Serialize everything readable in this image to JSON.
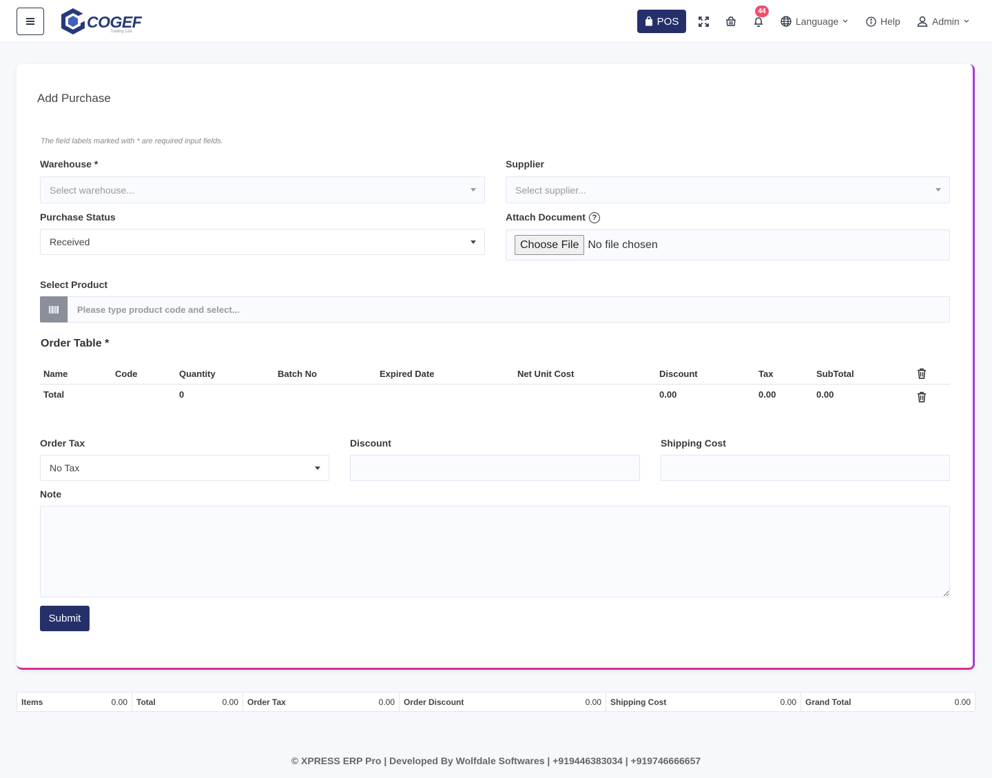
{
  "header": {
    "logo_text": "COGEF",
    "logo_subtitle": "Trading Lda",
    "pos_label": "POS",
    "notification_count": "44",
    "language_label": "Language",
    "help_label": "Help",
    "user_label": "Admin"
  },
  "form": {
    "title": "Add Purchase",
    "required_hint": "The field labels marked with * are required input fields.",
    "warehouse": {
      "label": "Warehouse *",
      "placeholder": "Select warehouse..."
    },
    "supplier": {
      "label": "Supplier",
      "placeholder": "Select supplier..."
    },
    "purchase_status": {
      "label": "Purchase Status",
      "value": "Received"
    },
    "attach_document": {
      "label": "Attach Document",
      "button": "Choose File",
      "status": "No file chosen"
    },
    "select_product": {
      "label": "Select Product",
      "placeholder": "Please type product code and select..."
    },
    "order_table": {
      "title": "Order Table *",
      "columns": [
        "Name",
        "Code",
        "Quantity",
        "Batch No",
        "Expired Date",
        "Net Unit Cost",
        "Discount",
        "Tax",
        "SubTotal"
      ],
      "total_row": {
        "label": "Total",
        "quantity": "0",
        "discount": "0.00",
        "tax": "0.00",
        "subtotal": "0.00"
      }
    },
    "order_tax": {
      "label": "Order Tax",
      "value": "No Tax"
    },
    "discount": {
      "label": "Discount",
      "value": ""
    },
    "shipping_cost": {
      "label": "Shipping Cost",
      "value": ""
    },
    "note": {
      "label": "Note",
      "value": ""
    },
    "submit_label": "Submit"
  },
  "totals_bar": [
    {
      "label": "Items",
      "value": "0.00"
    },
    {
      "label": "Total",
      "value": "0.00"
    },
    {
      "label": "Order Tax",
      "value": "0.00"
    },
    {
      "label": "Order Discount",
      "value": "0.00"
    },
    {
      "label": "Shipping Cost",
      "value": "0.00"
    },
    {
      "label": "Grand Total",
      "value": "0.00"
    }
  ],
  "footer": {
    "text": "© XPRESS ERP Pro | Developed By Wolfdale Softwares | +919446383034 | +919746666657"
  },
  "colors": {
    "primary": "#25306b",
    "badge": "#f0506e",
    "card_border_right": "#a83bd8",
    "card_border_bottom": "#d92d94"
  }
}
